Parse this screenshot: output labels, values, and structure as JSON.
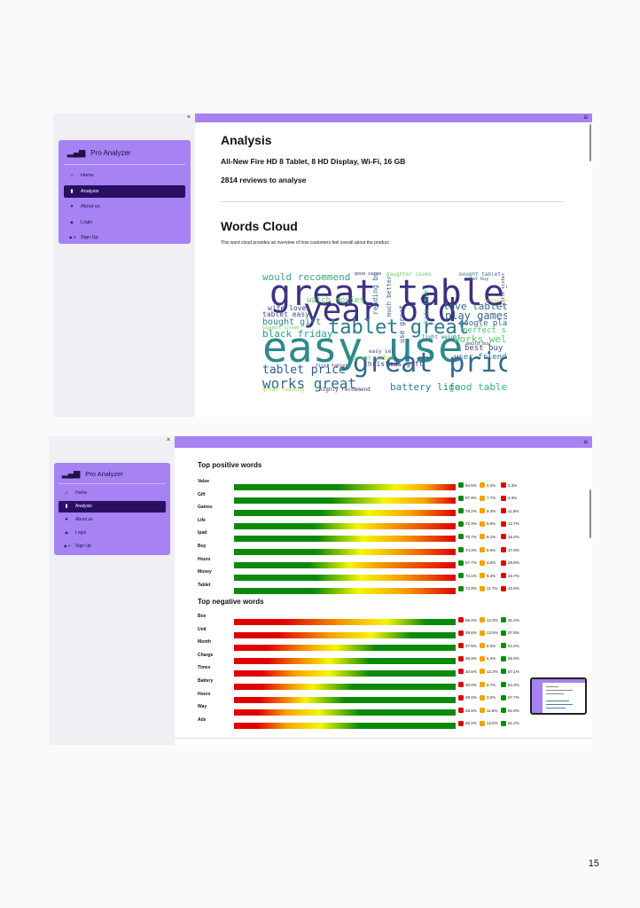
{
  "sidebar": {
    "close": "×",
    "app_title": "Pro Analyzer",
    "items": [
      {
        "label": "Home",
        "icon": "home-icon",
        "glyph": "⌂",
        "active": false
      },
      {
        "label": "Analysis",
        "icon": "bar-chart-icon",
        "glyph": "▮",
        "active": true
      },
      {
        "label": "About us",
        "icon": "info-icon",
        "glyph": "●",
        "active": false
      },
      {
        "label": "Login",
        "icon": "user-icon",
        "glyph": "▲",
        "active": false
      },
      {
        "label": "Sign Up",
        "icon": "user-plus-icon",
        "glyph": "▲+",
        "active": false
      }
    ]
  },
  "topbar": {
    "menu_icon": "≡"
  },
  "analysis": {
    "title": "Analysis",
    "product": "All-New Fire HD 8 Tablet, 8 HD Display, Wi-Fi, 16 GB",
    "reviews": "2814 reviews to analyse"
  },
  "words_cloud": {
    "title": "Words Cloud",
    "description": "This word cloud provides an overview of how customers feel overall about the product",
    "words": [
      {
        "text": "great tablet",
        "color": "#3b3382"
      },
      {
        "text": "easy use",
        "color": "#2b8a8c"
      },
      {
        "text": "year old",
        "color": "#3b3382"
      },
      {
        "text": "great price",
        "color": "#31688e"
      },
      {
        "text": "tablet great",
        "color": "#2a7b8e"
      },
      {
        "text": "would recommend",
        "color": "#3aa57e"
      },
      {
        "text": "love tablet",
        "color": "#32648e"
      },
      {
        "text": "play games",
        "color": "#31688e"
      },
      {
        "text": "black friday",
        "color": "#1f9e89"
      },
      {
        "text": "works well",
        "color": "#55c667"
      },
      {
        "text": "tablet price",
        "color": "#2a5d8e"
      },
      {
        "text": "works great",
        "color": "#2e6d8e"
      },
      {
        "text": "battery life",
        "color": "#26828e"
      },
      {
        "text": "good tablet",
        "color": "#35b779"
      },
      {
        "text": "best buy",
        "color": "#404788"
      },
      {
        "text": "user friendly",
        "color": "#2c728e"
      },
      {
        "text": "google play",
        "color": "#31688e"
      },
      {
        "text": "perfect size",
        "color": "#4ac16d"
      },
      {
        "text": "bought gift",
        "color": "#26828e"
      },
      {
        "text": "tablet easy",
        "color": "#3e4a89"
      },
      {
        "text": "wife loves",
        "color": "#433e85"
      },
      {
        "text": "christmas gift",
        "color": "#443a83"
      },
      {
        "text": "watch movies",
        "color": "#5ec962"
      },
      {
        "text": "great value",
        "color": "#7ad151"
      },
      {
        "text": "great reading",
        "color": "#a0da39"
      },
      {
        "text": "highly recommend",
        "color": "#46337e"
      },
      {
        "text": "easy set",
        "color": "#3b528b"
      },
      {
        "text": "light weight",
        "color": "#2d708e"
      },
      {
        "text": "good value",
        "color": "#482677"
      },
      {
        "text": "daughter loves",
        "color": "#65cb5e"
      },
      {
        "text": "bought tablet",
        "color": "#2a788e"
      },
      {
        "text": "great buy",
        "color": "#3b528b"
      },
      {
        "text": "would buy",
        "color": "#482878"
      },
      {
        "text": "reading books",
        "color": "#2c728e"
      },
      {
        "text": "much better",
        "color": "#365c8d"
      },
      {
        "text": "use great",
        "color": "#3e4989"
      },
      {
        "text": "first tablet",
        "color": "#472d7b"
      },
      {
        "text": "biggest screen",
        "color": "#6ece58"
      },
      {
        "text": "little sister",
        "color": "#482475"
      },
      {
        "text": "reading apps",
        "color": "#addc30"
      },
      {
        "text": "kids love",
        "color": "#2fb47c"
      }
    ]
  },
  "positive": {
    "title": "Top positive words",
    "rows": [
      {
        "word": "Value",
        "g": 94.5,
        "o": 2.2,
        "r": 3.3
      },
      {
        "word": "Gift",
        "g": 87.9,
        "o": 7.7,
        "r": 4.3
      },
      {
        "word": "Games",
        "g": 79.2,
        "o": 9.3,
        "r": 11.6
      },
      {
        "word": "Life",
        "g": 72.3,
        "o": 5.0,
        "r": 12.7
      },
      {
        "word": "Ipad",
        "g": 75.7,
        "o": 8.1,
        "r": 16.2
      },
      {
        "word": "Buy",
        "g": 74.3,
        "o": 8.0,
        "r": 17.9
      },
      {
        "word": "Hours",
        "g": 67.7,
        "o": 3.2,
        "r": 28.9
      },
      {
        "word": "Money",
        "g": 74.1,
        "o": 9.3,
        "r": 16.7
      },
      {
        "word": "Tablet",
        "g": 72.8,
        "o": 11.7,
        "r": 15.5
      }
    ]
  },
  "negative": {
    "title": "Top negative words",
    "rows": [
      {
        "word": "Box",
        "r": 56.2,
        "o": 12.5,
        "g": 31.2
      },
      {
        "word": "Unit",
        "r": 48.6,
        "o": 13.5,
        "g": 37.8
      },
      {
        "word": "Month",
        "r": 37.5,
        "o": 8.3,
        "g": 54.2
      },
      {
        "word": "Charge",
        "r": 36.9,
        "o": 6.3,
        "g": 56.9
      },
      {
        "word": "Times",
        "r": 30.6,
        "o": 12.2,
        "g": 57.1
      },
      {
        "word": "Battery",
        "r": 30.0,
        "o": 5.7,
        "g": 64.3
      },
      {
        "word": "Hours",
        "r": 29.0,
        "o": 3.2,
        "g": 67.7
      },
      {
        "word": "Way",
        "r": 26.5,
        "o": 11.8,
        "g": 61.8
      },
      {
        "word": "Ads",
        "r": 26.2,
        "o": 12.6,
        "g": 61.2
      }
    ]
  },
  "colors": {
    "accent": "#a682f2",
    "active": "#2a1063",
    "green": "#0a8a0a",
    "orange": "#f5a300",
    "red": "#e00000",
    "yellow": "#f6f600"
  },
  "page_number": "15"
}
